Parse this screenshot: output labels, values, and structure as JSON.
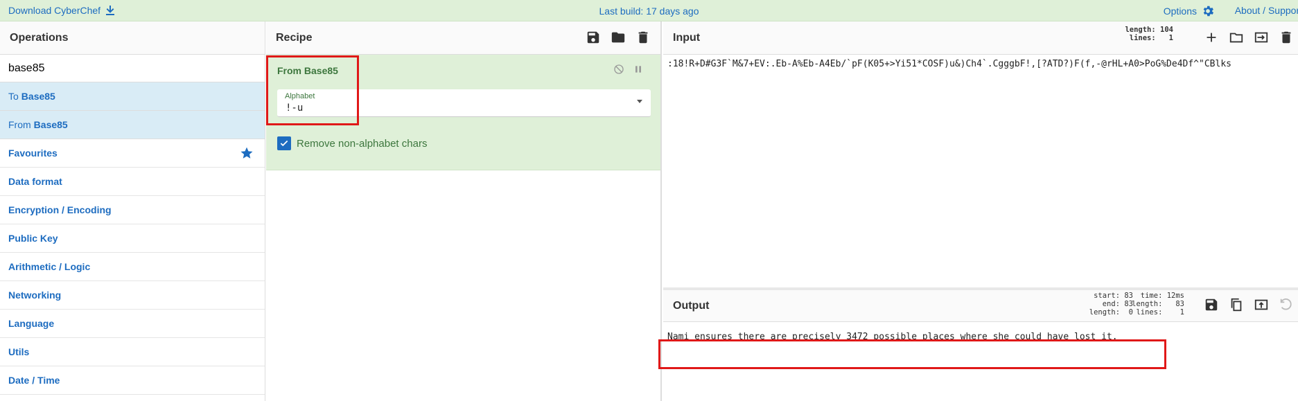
{
  "banner": {
    "download_label": "Download CyberChef",
    "last_build": "Last build: 17 days ago",
    "options_label": "Options",
    "about_label": "About / Support"
  },
  "operations": {
    "title": "Operations",
    "search_value": "base85",
    "results": [
      {
        "prefix": "To",
        "name": "Base85"
      },
      {
        "prefix": "From",
        "name": "Base85"
      }
    ],
    "categories": [
      "Favourites",
      "Data format",
      "Encryption / Encoding",
      "Public Key",
      "Arithmetic / Logic",
      "Networking",
      "Language",
      "Utils",
      "Date / Time"
    ]
  },
  "recipe": {
    "title": "Recipe",
    "ingredient": {
      "name": "From Base85",
      "alphabet_label": "Alphabet",
      "alphabet_value": "!-u",
      "checkbox_label": "Remove non-alphabet chars",
      "checkbox_checked": true
    }
  },
  "input": {
    "title": "Input",
    "meta": "length: 104\n lines:   1",
    "text": ":18!R+D#G3F`M&7+EV:.Eb-A%Eb-A4Eb/`pF(K05+>Yi51*COSF)u&)Ch4`.CgggbF!,[?ATD?)F(f,-@rHL+A0>PoG%De4Df^\"CBlks"
  },
  "output": {
    "title": "Output",
    "meta_left": "start: 83\n  end: 83\nlength:  0",
    "meta_right": "  time: 12ms\nlength:   83\n lines:    1",
    "text": "Nami ensures there are precisely 3472 possible places where she could have lost it."
  },
  "colors": {
    "accent": "#1d6cc0",
    "banner_bg": "#dff0d8",
    "ingredient_bg": "#dff0d8",
    "highlight": "#e01818"
  }
}
